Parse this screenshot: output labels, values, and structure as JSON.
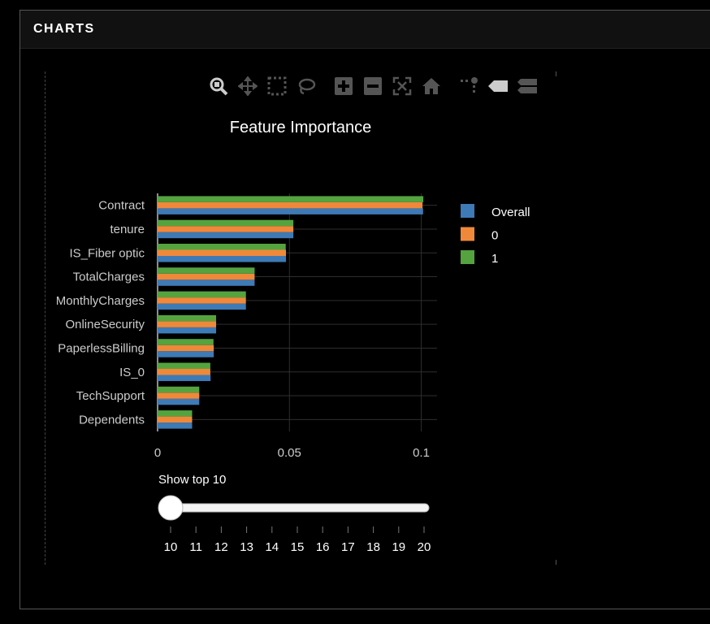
{
  "panel": {
    "title": "CHARTS"
  },
  "toolbar": {
    "icons": [
      "zoom-icon",
      "pan-icon",
      "box-select-icon",
      "lasso-select-icon",
      "zoom-in-icon",
      "zoom-out-icon",
      "autoscale-icon",
      "reset-axes-icon",
      "spike-lines-icon",
      "hover-closest-icon",
      "hover-compare-icon"
    ]
  },
  "slider": {
    "label": "Show top 10",
    "value": 10,
    "min": 10,
    "max": 20,
    "ticks": [
      "10",
      "11",
      "12",
      "13",
      "14",
      "15",
      "16",
      "17",
      "18",
      "19",
      "20"
    ],
    "handle_color": "#ffffff"
  },
  "chart_data": {
    "type": "bar",
    "orientation": "horizontal",
    "title": "Feature Importance",
    "categories": [
      "Contract",
      "tenure",
      "IS_Fiber optic",
      "TotalCharges",
      "MonthlyCharges",
      "OnlineSecurity",
      "PaperlessBilling",
      "IS_0",
      "TechSupport",
      "Dependents"
    ],
    "series": [
      {
        "name": "Overall",
        "color": "#3e7ab6",
        "values": [
          0.1007,
          0.0515,
          0.0487,
          0.0368,
          0.0335,
          0.0222,
          0.0213,
          0.0201,
          0.0158,
          0.0131
        ]
      },
      {
        "name": "0",
        "color": "#f0883a",
        "values": [
          0.1005,
          0.0515,
          0.0487,
          0.0368,
          0.0335,
          0.0222,
          0.0213,
          0.02,
          0.0158,
          0.0131
        ]
      },
      {
        "name": "1",
        "color": "#55a33f",
        "values": [
          0.1008,
          0.0515,
          0.0486,
          0.0368,
          0.0335,
          0.0222,
          0.0212,
          0.02,
          0.0158,
          0.0131
        ]
      }
    ],
    "xlim": [
      0,
      0.106
    ],
    "xticks": [
      0,
      0.05,
      0.1
    ],
    "xtick_labels": [
      "0",
      "0.05",
      "0.1"
    ],
    "grid": true,
    "legend_position": "right"
  }
}
